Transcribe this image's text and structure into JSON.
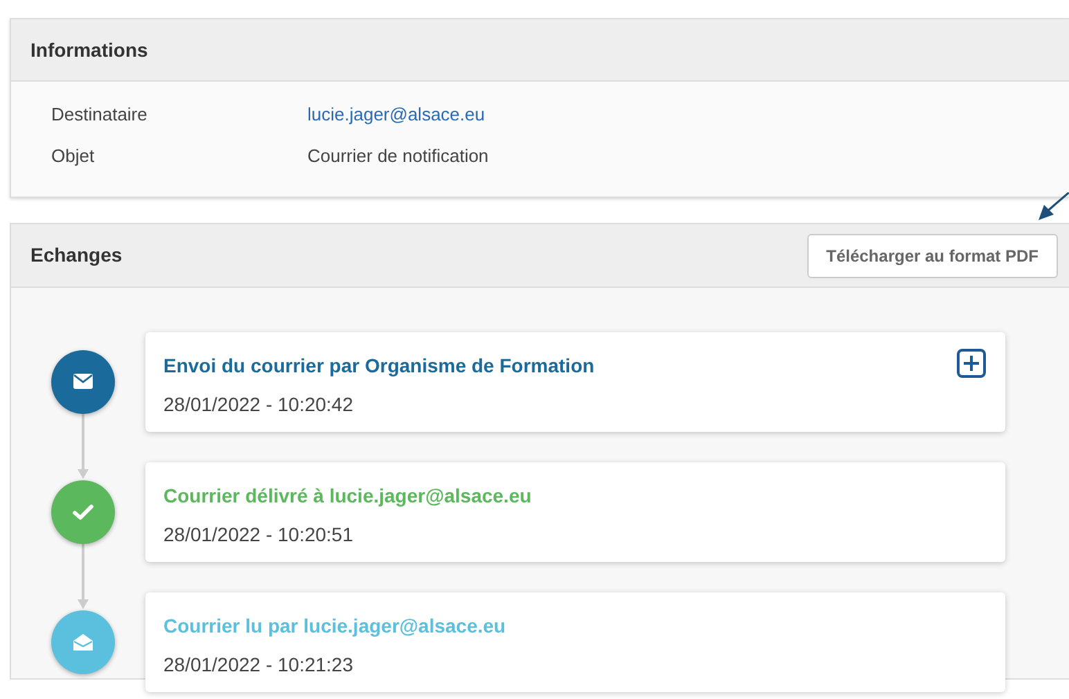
{
  "info_panel": {
    "title": "Informations",
    "fields": [
      {
        "label": "Destinataire",
        "value": "lucie.jager@alsace.eu",
        "kind": "link"
      },
      {
        "label": "Objet",
        "value": "Courrier de notification",
        "kind": "text"
      }
    ]
  },
  "exchanges_panel": {
    "title": "Echanges",
    "download_button": "Télécharger au format PDF",
    "events": [
      {
        "kind": "sent",
        "title": "Envoi du courrier par Organisme de Formation",
        "time": "28/01/2022 - 10:20:42",
        "color": "#1a6a9c",
        "expandable": true
      },
      {
        "kind": "delivered",
        "title": "Courrier délivré à lucie.jager@alsace.eu",
        "time": "28/01/2022 - 10:20:51",
        "color": "#5cb85c",
        "expandable": false
      },
      {
        "kind": "read",
        "title": "Courrier lu par lucie.jager@alsace.eu",
        "time": "28/01/2022 - 10:21:23",
        "color": "#5bc0de",
        "expandable": false
      }
    ]
  }
}
